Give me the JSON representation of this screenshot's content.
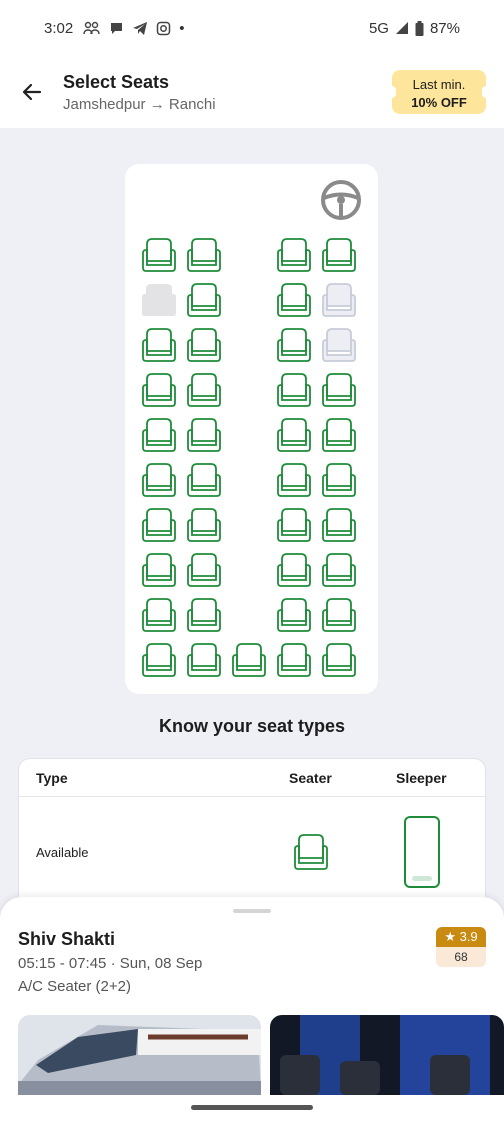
{
  "status": {
    "time": "3:02",
    "network": "5G",
    "battery": "87%",
    "dot": "•"
  },
  "header": {
    "title": "Select Seats",
    "from": "Jamshedpur",
    "arrow": "→",
    "to": "Ranchi",
    "offer_line1": "Last min.",
    "offer_line2": "10% OFF"
  },
  "legend": {
    "title": "Know your seat types",
    "col_type": "Type",
    "col_seater": "Seater",
    "col_sleeper": "Sleeper",
    "row_available": "Available"
  },
  "bus": {
    "name": "Shiv Shakti",
    "timing": "05:15 - 07:45 · Sun, 08 Sep",
    "type": "A/C Seater (2+2)",
    "rating": "3.9",
    "rating_count": "68",
    "star": "★"
  },
  "colors": {
    "available": "#1e8c3a",
    "booked": "#e3e3e6",
    "booked_outline": "#c8ccd8",
    "offer_bg": "#fde59b",
    "rating_bg": "#c98a12"
  },
  "seat_rows": [
    [
      "A",
      "A",
      "-",
      "A",
      "A"
    ],
    [
      "B",
      "A",
      "-",
      "A",
      "F"
    ],
    [
      "A",
      "A",
      "-",
      "A",
      "F"
    ],
    [
      "A",
      "A",
      "-",
      "A",
      "A"
    ],
    [
      "A",
      "A",
      "-",
      "A",
      "A"
    ],
    [
      "A",
      "A",
      "-",
      "A",
      "A"
    ],
    [
      "A",
      "A",
      "-",
      "A",
      "A"
    ],
    [
      "A",
      "A",
      "-",
      "A",
      "A"
    ],
    [
      "A",
      "A",
      "-",
      "A",
      "A"
    ],
    [
      "A",
      "A",
      "A",
      "A",
      "A"
    ]
  ]
}
